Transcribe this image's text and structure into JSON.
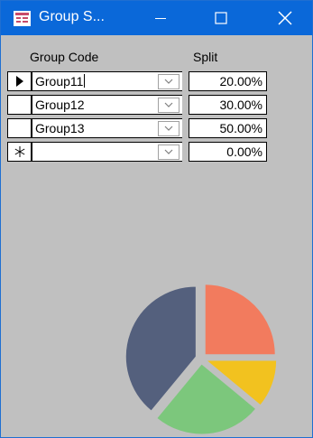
{
  "window": {
    "title": "Group S..."
  },
  "grid": {
    "headers": {
      "group_code": "Group Code",
      "split": "Split"
    },
    "rows": [
      {
        "selector": "▶",
        "group_code": "Group11",
        "split": "20.00%"
      },
      {
        "selector": "",
        "group_code": "Group12",
        "split": "30.00%"
      },
      {
        "selector": "",
        "group_code": "Group13",
        "split": "50.00%"
      },
      {
        "selector": "✳",
        "group_code": "",
        "split": "0.00%"
      }
    ]
  },
  "chart_data": {
    "type": "pie",
    "title": "",
    "slices": [
      {
        "value": 25,
        "color": "#f27b5e"
      },
      {
        "value": 11,
        "color": "#f2c21f"
      },
      {
        "value": 25,
        "color": "#7cc77c"
      },
      {
        "value": 39,
        "color": "#54607d"
      }
    ]
  }
}
